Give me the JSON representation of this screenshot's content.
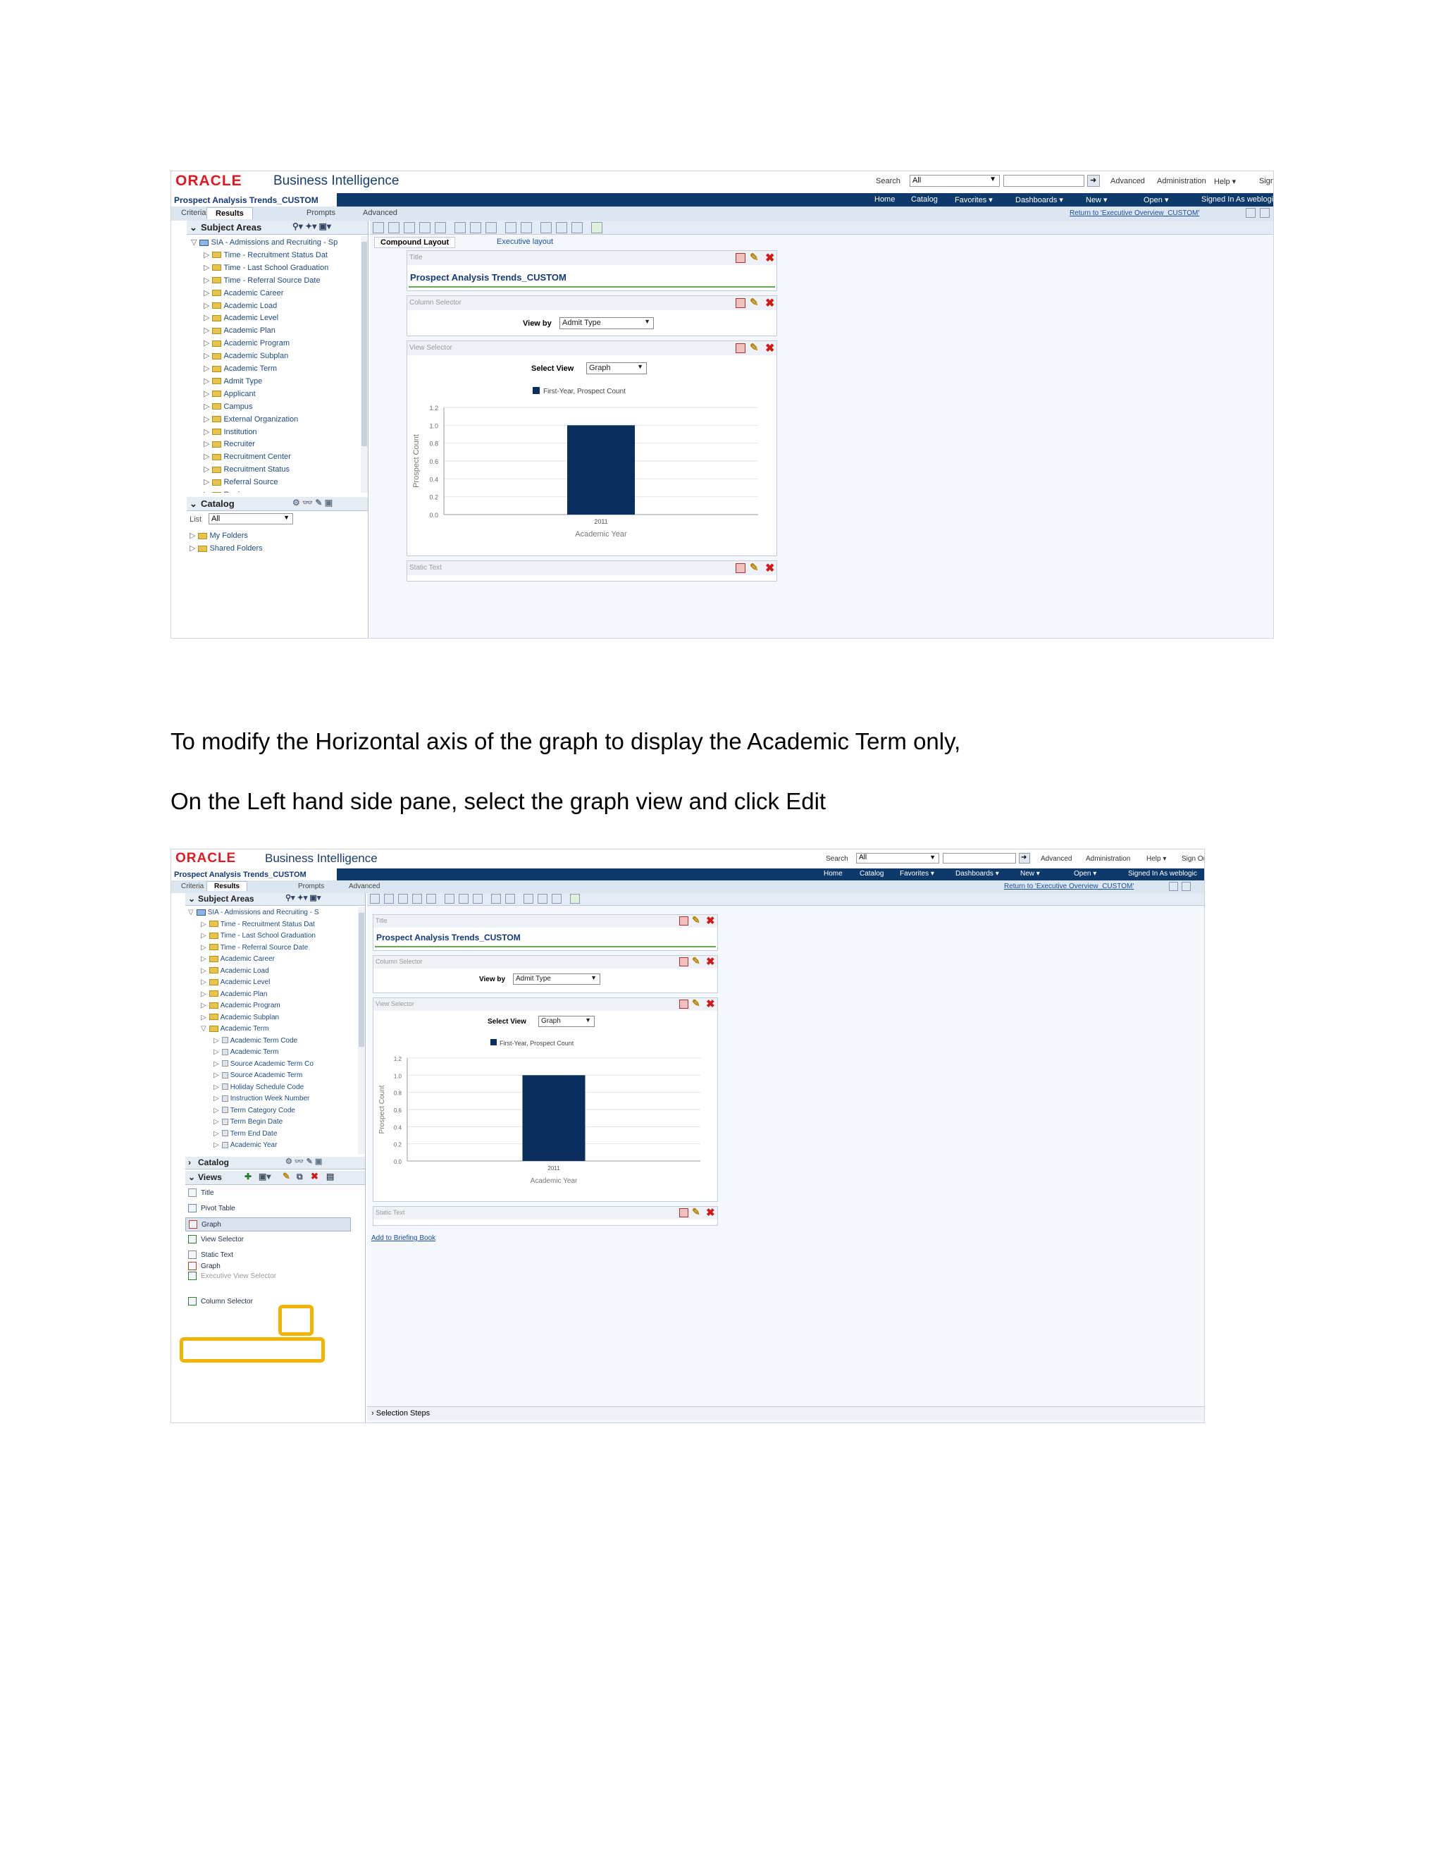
{
  "app": {
    "logo": "ORACLE",
    "product": "Business Intelligence",
    "search_label": "Search",
    "search_scope": "All",
    "top_links": [
      "Advanced",
      "Administration",
      "Help ▾",
      "Sign Out"
    ],
    "analysis_title": "Prospect Analysis Trends_CUSTOM",
    "menu": [
      "Home",
      "Catalog",
      "Favorites ▾",
      "Dashboards ▾",
      "New ▾",
      "Open ▾",
      "Signed In As  weblogic"
    ],
    "return_link": "Return to 'Executive Overview_CUSTOM'",
    "tabs": [
      "Criteria",
      "Results",
      "Prompts",
      "Advanced"
    ],
    "subject_areas_label": "Subject Areas",
    "layout_tabs": [
      "Compound Layout",
      "Executive layout"
    ],
    "catalog_label": "Catalog",
    "list_label": "List",
    "list_value": "All",
    "catalog_folders": [
      "My Folders",
      "Shared Folders"
    ],
    "views_label": "Views",
    "add_to_briefing": "Add to Briefing Book",
    "selection_steps": "Selection Steps"
  },
  "tree1": [
    "SIA - Admissions and Recruiting - Sp",
    "Time - Recruitment Status Dat",
    "Time - Last School Graduation",
    "Time - Referral Source Date",
    "Academic Career",
    "Academic Load",
    "Academic Level",
    "Academic Plan",
    "Academic Program",
    "Academic Subplan",
    "Academic Term",
    "Admit Type",
    "Applicant",
    "Campus",
    "External Organization",
    "Institution",
    "Recruiter",
    "Recruitment Center",
    "Recruitment Status",
    "Referral Source",
    "Region"
  ],
  "tree2": [
    "SIA - Admissions and Recruiting - S",
    "Time - Recruitment Status Dat",
    "Time - Last School Graduation",
    "Time - Referral Source Date",
    "Academic Career",
    "Academic Load",
    "Academic Level",
    "Academic Plan",
    "Academic Program",
    "Academic Subplan",
    "Academic Term",
    "Academic Term Code",
    "Academic Term",
    "Source Academic Term Co",
    "Source Academic Term",
    "Holiday Schedule Code",
    "Instruction Week Number",
    "Term Category Code",
    "Term Begin Date",
    "Term End Date",
    "Academic Year"
  ],
  "views": [
    "Title",
    "Pivot Table",
    "Graph",
    "View Selector",
    "Static Text",
    "Graph",
    "Executive View Selector",
    "Column Selector"
  ],
  "compound": {
    "title_label": "Title",
    "title_value": "Prospect Analysis Trends_CUSTOM",
    "column_selector_label": "Column Selector",
    "view_by_label": "View by",
    "view_by_value": "Admit Type",
    "view_selector_label": "View Selector",
    "select_view_label": "Select View",
    "select_view_value": "Graph",
    "static_text_label": "Static Text"
  },
  "instructions": [
    "To modify the Horizontal axis of the graph to display the Academic Term only,",
    "On the Left hand side pane, select the graph view and click Edit"
  ],
  "colors": {
    "bar": "#0a2f5e",
    "highlight": "#f2b300",
    "header_bar": "#0e3a6b",
    "logo": "#e01a22"
  },
  "chart_data": {
    "type": "bar",
    "categories": [
      "2011"
    ],
    "series": [
      {
        "name": "First-Year, Prospect Count",
        "values": [
          1.0
        ]
      }
    ],
    "xlabel": "Academic Year",
    "ylabel": "Prospect Count",
    "ylim": [
      0,
      1.2
    ],
    "yticks": [
      "0.0",
      "0.2",
      "0.4",
      "0.6",
      "0.8",
      "1.0",
      "1.2"
    ],
    "grid": true,
    "legend": "top"
  }
}
